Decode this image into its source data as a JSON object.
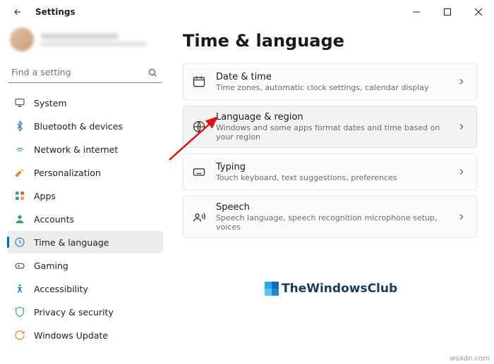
{
  "window": {
    "title": "Settings",
    "minimize": "–",
    "maximize": "☐",
    "close": "✕",
    "back": "←"
  },
  "search": {
    "placeholder": "Find a setting",
    "icon": "search"
  },
  "nav": {
    "items": [
      {
        "label": "System",
        "icon": "system"
      },
      {
        "label": "Bluetooth & devices",
        "icon": "bluetooth"
      },
      {
        "label": "Network & internet",
        "icon": "network"
      },
      {
        "label": "Personalization",
        "icon": "personalization"
      },
      {
        "label": "Apps",
        "icon": "apps"
      },
      {
        "label": "Accounts",
        "icon": "accounts"
      },
      {
        "label": "Time & language",
        "icon": "time"
      },
      {
        "label": "Gaming",
        "icon": "gaming"
      },
      {
        "label": "Accessibility",
        "icon": "accessibility"
      },
      {
        "label": "Privacy & security",
        "icon": "privacy"
      },
      {
        "label": "Windows Update",
        "icon": "update"
      }
    ],
    "selectedIndex": 6
  },
  "page": {
    "title": "Time & language",
    "cards": [
      {
        "title": "Date & time",
        "subtitle": "Time zones, automatic clock settings, calendar display",
        "icon": "clock"
      },
      {
        "title": "Language & region",
        "subtitle": "Windows and some apps format dates and time based on your region",
        "icon": "globe"
      },
      {
        "title": "Typing",
        "subtitle": "Touch keyboard, text suggestions, preferences",
        "icon": "keyboard"
      },
      {
        "title": "Speech",
        "subtitle": "Speech language, speech recognition microphone setup, voices",
        "icon": "speech"
      }
    ],
    "highlightedIndex": 1
  },
  "watermark": "TheWindowsClub",
  "attribution": "wsxdn.com"
}
